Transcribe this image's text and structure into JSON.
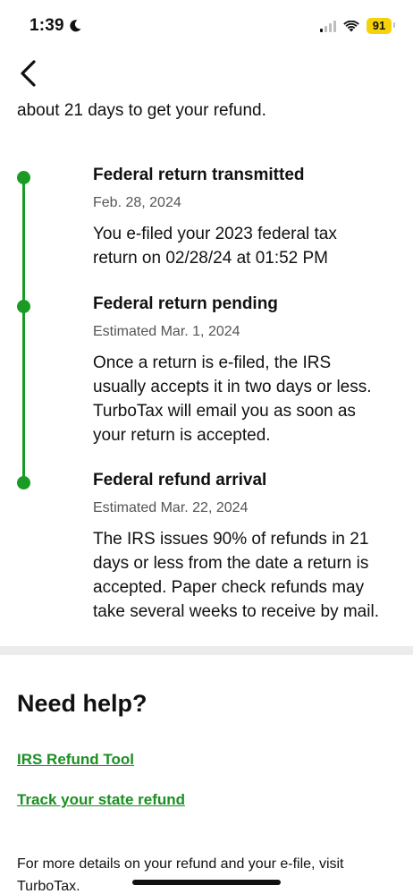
{
  "status_bar": {
    "time": "1:39",
    "battery": "91"
  },
  "intro": "about 21 days to get your refund.",
  "timeline": [
    {
      "title": "Federal return transmitted",
      "date": "Feb. 28, 2024",
      "description": "You e-filed your 2023 federal tax return on 02/28/24 at 01:52 PM"
    },
    {
      "title": "Federal return pending",
      "date": "Estimated Mar. 1, 2024",
      "description": "Once a return is e-filed, the IRS usually accepts it in two days or less. TurboTax will email you as soon as your return is accepted."
    },
    {
      "title": "Federal refund arrival",
      "date": "Estimated Mar. 22, 2024",
      "description": "The IRS issues 90% of refunds in 21 days or less from the date a return is accepted. Paper check refunds may take several weeks to receive by mail."
    }
  ],
  "help": {
    "title": "Need help?",
    "links": [
      "IRS Refund Tool",
      "Track your state refund"
    ],
    "footer": "For more details on your refund and your e-file, visit TurboTax."
  },
  "colors": {
    "accent": "#1a9b23",
    "link": "#1a8f22",
    "battery": "#f5d20a"
  }
}
